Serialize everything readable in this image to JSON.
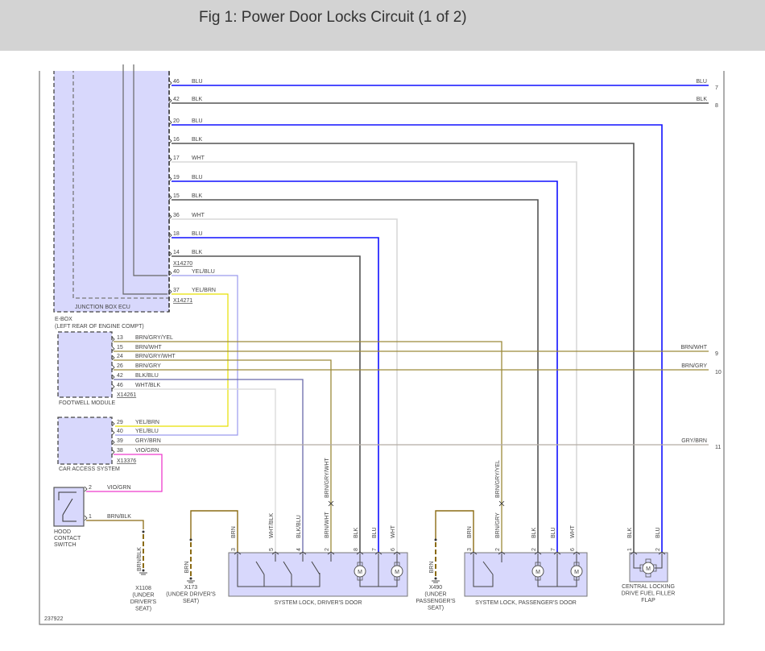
{
  "header": {
    "title": "Fig 1: Power Door Locks Circuit (1 of 2)"
  },
  "colors": {
    "BLU": "#1010ff",
    "BLK": "#555555",
    "WHT": "#d8d8d8",
    "YEL_BLU": "#9a9aee",
    "YEL_BRN": "#e6e000",
    "BRN": "#8b6b14",
    "BRN_MIX": "#9c8a3a",
    "BLK_BLU": "#6a6aaa",
    "GRY_BRN": "#b5aca4",
    "VIO_GRN": "#ee3ccc",
    "module_fill": "#d8d8fc"
  },
  "components": {
    "junction_box": "JUNCTION BOX ECU",
    "ebox": "E-BOX",
    "ebox_location": "(LEFT REAR OF ENGINE COMPT)",
    "footwell": "FOOTWELL MODULE",
    "cas": "CAR ACCESS SYSTEM",
    "hood": [
      "HOOD",
      "CONTACT",
      "SWITCH"
    ],
    "driver_door": "SYSTEM LOCK, DRIVER'S DOOR",
    "passenger_door": "SYSTEM LOCK, PASSENGER'S DOOR",
    "fuel_flap": [
      "CENTRAL LOCKING",
      "DRIVE FUEL FILLER",
      "FLAP"
    ]
  },
  "connectors": {
    "jb_upper": "X14270",
    "jb_lower": "X14271",
    "footwell": "X14261",
    "cas": "X13376"
  },
  "jb_pins": [
    {
      "pin": "46",
      "wire": "BLU"
    },
    {
      "pin": "42",
      "wire": "BLK"
    },
    {
      "pin": "20",
      "wire": "BLU"
    },
    {
      "pin": "16",
      "wire": "BLK"
    },
    {
      "pin": "17",
      "wire": "WHT"
    },
    {
      "pin": "19",
      "wire": "BLU"
    },
    {
      "pin": "15",
      "wire": "BLK"
    },
    {
      "pin": "36",
      "wire": "WHT"
    },
    {
      "pin": "18",
      "wire": "BLU"
    },
    {
      "pin": "14",
      "wire": "BLK"
    },
    {
      "pin": "40",
      "wire": "YEL/BLU"
    },
    {
      "pin": "37",
      "wire": "YEL/BRN"
    }
  ],
  "footwell_pins": [
    {
      "pin": "13",
      "wire": "BRN/GRY/YEL"
    },
    {
      "pin": "15",
      "wire": "BRN/WHT"
    },
    {
      "pin": "24",
      "wire": "BRN/GRY/WHT"
    },
    {
      "pin": "26",
      "wire": "BRN/GRY"
    },
    {
      "pin": "42",
      "wire": "BLK/BLU"
    },
    {
      "pin": "46",
      "wire": "WHT/BLK"
    }
  ],
  "cas_pins": [
    {
      "pin": "29",
      "wire": "YEL/BRN"
    },
    {
      "pin": "40",
      "wire": "YEL/BLU"
    },
    {
      "pin": "39",
      "wire": "GRY/BRN"
    },
    {
      "pin": "38",
      "wire": "VIO/GRN"
    }
  ],
  "hood_pins": [
    {
      "pin": "2",
      "wire": "VIO/GRN"
    },
    {
      "pin": "1",
      "wire": "BRN/BLK"
    }
  ],
  "offpage": [
    {
      "wire": "BLU",
      "ref": "7"
    },
    {
      "wire": "BLK",
      "ref": "8"
    },
    {
      "wire": "BRN/WHT",
      "ref": "9"
    },
    {
      "wire": "BRN/GRY",
      "ref": "10"
    },
    {
      "wire": "GRY/BRN",
      "ref": "11"
    }
  ],
  "driver_pins": [
    {
      "pin": "3",
      "wire": "BRN"
    },
    {
      "pin": "5",
      "wire": "WHT/BLK"
    },
    {
      "pin": "4",
      "wire": "BLK/BLU"
    },
    {
      "pin": "2",
      "wire": "BRN/WHT"
    },
    {
      "pin": "8",
      "wire": "BLK"
    },
    {
      "pin": "7",
      "wire": "BLU"
    },
    {
      "pin": "6",
      "wire": "WHT"
    }
  ],
  "driver_inline_upper": "BRN/GRY/WHT",
  "passenger_pins": [
    {
      "pin": "3",
      "wire": "BRN"
    },
    {
      "pin": "2",
      "wire": "BRN/GRY"
    },
    {
      "pin": "2",
      "wire": "BLK"
    },
    {
      "pin": "7",
      "wire": "BLU"
    },
    {
      "pin": "6",
      "wire": "WHT"
    }
  ],
  "passenger_inline_upper": "BRN/GRY/YEL",
  "flap_pins": [
    {
      "pin": "1",
      "wire": "BLK"
    },
    {
      "pin": "2",
      "wire": "BLU"
    }
  ],
  "grounds": [
    {
      "id": "X1108",
      "location": [
        "(UNDER",
        "DRIVER'S",
        "SEAT)"
      ],
      "wire": "BRN/BLK"
    },
    {
      "id": "X173",
      "location": [
        "(UNDER DRIVER'S",
        "SEAT)"
      ],
      "wire": "BRN"
    },
    {
      "id": "X490",
      "location": [
        "(UNDER",
        "PASSENGER'S",
        "SEAT)"
      ],
      "wire": "BRN"
    }
  ],
  "motor_symbol": "M",
  "diagram_id": "237922"
}
